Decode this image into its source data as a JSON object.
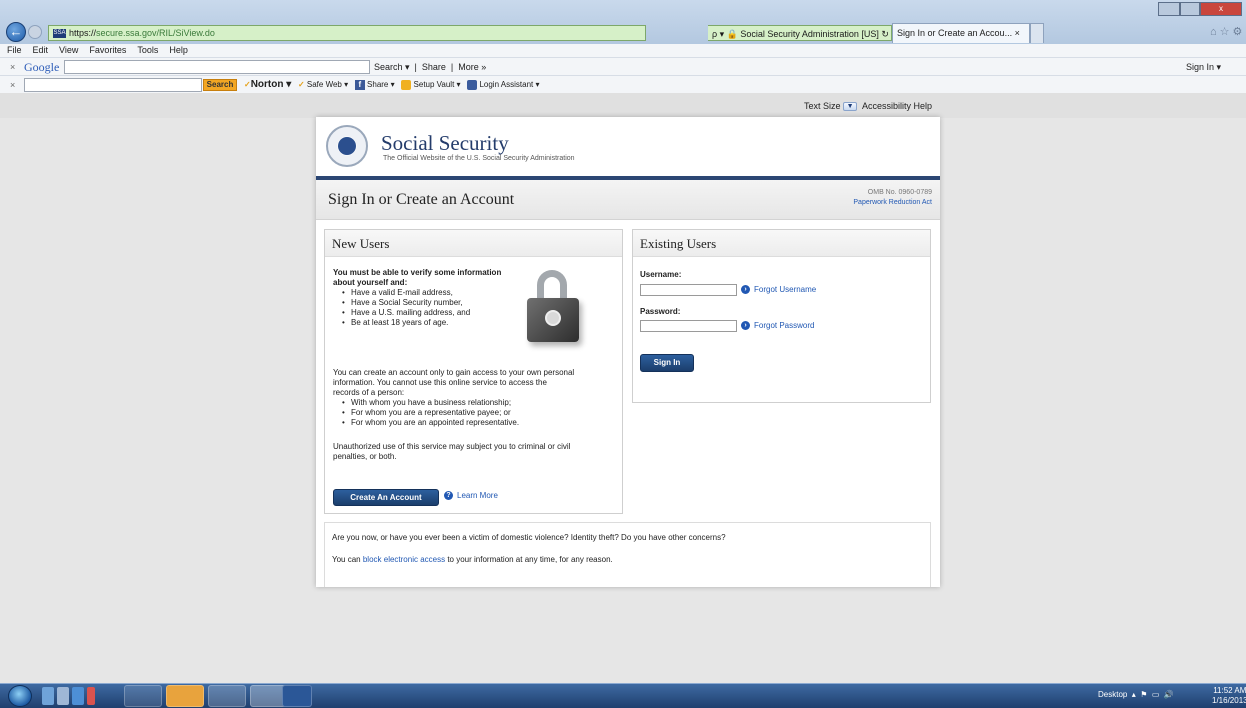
{
  "browser": {
    "url_prefix": "https://",
    "url_domain": "secure.ssa.gov",
    "url_path": "/RIL/SiView.do",
    "addr_right": "ρ ▾ 🔒 Social Security Administration [US] ↻ ✕",
    "tab_title": "Sign In or Create an Accou... ×",
    "window_close": "x",
    "menu": [
      "File",
      "Edit",
      "View",
      "Favorites",
      "Tools",
      "Help"
    ],
    "google": {
      "logo": "Google",
      "search": "Search ▾",
      "share": "Share",
      "more": "More »",
      "signin": "Sign In ▾"
    },
    "norton": {
      "search_button": "Search",
      "logo": "Norton ▾",
      "safe_web": "Safe Web ▾",
      "share": "Share ▾",
      "vault": "Setup Vault ▾",
      "login": "Login Assistant ▾"
    }
  },
  "page": {
    "text_size": "Text Size",
    "accessibility": "Accessibility Help",
    "brand": "Social Security",
    "tagline": "The Official Website of the U.S. Social Security Administration",
    "title": "Sign In or Create an Account",
    "omb": "OMB No. 0960-0789",
    "paperwork": "Paperwork Reduction Act",
    "new_users": {
      "heading": "New Users",
      "intro_1": "You must be able to verify some information",
      "intro_2": "about yourself and:",
      "req": [
        "Have a valid E-mail address,",
        "Have a Social Security number,",
        "Have a U.S. mailing address, and",
        "Be at least 18 years of age."
      ],
      "access_1": "You can create an account only to gain access to your own personal",
      "access_2": "information. You cannot use this online service to access the",
      "access_3": "records of a person:",
      "persons": [
        "With whom you have a business relationship;",
        "For whom you are a representative payee; or",
        "For whom you are an appointed representative."
      ],
      "warn_1": "Unauthorized use of this service may subject you to criminal or civil",
      "warn_2": "penalties, or both.",
      "create_button": "Create An Account",
      "learn_more": "Learn More"
    },
    "existing_users": {
      "heading": "Existing Users",
      "username_label": "Username:",
      "forgot_username": "Forgot Username",
      "password_label": "Password:",
      "forgot_password": "Forgot Password",
      "signin_button": "Sign In"
    },
    "concern": {
      "question": "Are you now, or have you ever been a victim of domestic violence? Identity theft? Do you have other concerns?",
      "block_pre": "You can ",
      "block_link": "block electronic access",
      "block_post": " to your information at any time, for any reason."
    }
  },
  "taskbar": {
    "desktop": "Desktop",
    "time": "11:52 AM",
    "date": "1/16/2013"
  }
}
